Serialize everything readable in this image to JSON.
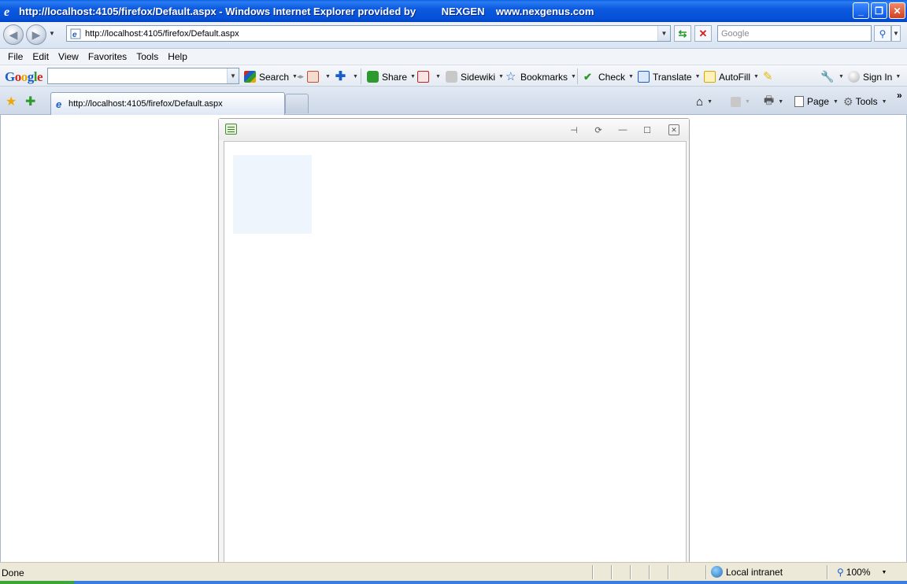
{
  "window": {
    "title": "http://localhost:4105/firefox/Default.aspx - Windows Internet Explorer provided by         NEXGEN    www.nexgenus.com",
    "controls": {
      "minimize": "_",
      "restore": "❐",
      "close": "✕"
    }
  },
  "address_bar": {
    "url": "http://localhost:4105/firefox/Default.aspx",
    "search_placeholder": "Google"
  },
  "menu": [
    "File",
    "Edit",
    "View",
    "Favorites",
    "Tools",
    "Help"
  ],
  "google_toolbar": {
    "logo": "Google",
    "search_label": "Search",
    "share_label": "Share",
    "sidewiki_label": "Sidewiki",
    "bookmarks_label": "Bookmarks",
    "check_label": "Check",
    "translate_label": "Translate",
    "autofill_label": "AutoFill",
    "sign_in_label": "Sign In"
  },
  "tabs": [
    {
      "label": "http://localhost:4105/firefox/Default.aspx",
      "active": true
    }
  ],
  "command_bar": {
    "page_label": "Page",
    "tools_label": "Tools",
    "overflow": "»"
  },
  "widget": {
    "icon": "widget-list-icon",
    "buttons": [
      "pin-icon",
      "refresh-icon",
      "minimize-icon",
      "maximize-icon",
      "close-icon"
    ]
  },
  "status_bar": {
    "status": "Done",
    "zone": "Local intranet",
    "zoom": "100%"
  },
  "colors": {
    "titlebar": "#0550d8",
    "placeholder_fill": "#eef5fd"
  }
}
